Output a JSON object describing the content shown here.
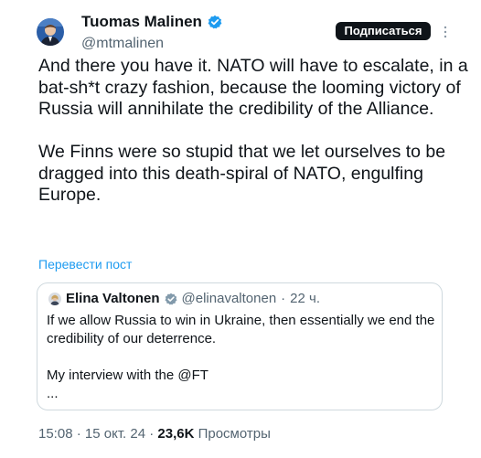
{
  "author": {
    "display_name": "Tuomas Malinen",
    "handle": "@mtmalinen",
    "verified_badge_icon": "verified-check-icon"
  },
  "follow_button_label": "Подписаться",
  "more_icon": "more-vertical-icon",
  "tweet": {
    "paragraph_1": "And there you have it. NATO will have to escalate, in a bat-sh*t crazy fashion, because the looming victory of Russia will annihilate the credibility of the Alliance.",
    "paragraph_2": "We Finns were so stupid that we let ourselves to be dragged into this death-spiral of NATO, engulfing Europe.",
    "translate_link": "Перевести пост"
  },
  "quoted_tweet": {
    "display_name": "Elina Valtonen",
    "handle": "@elinavaltonen",
    "separator": "·",
    "time_ago": "22 ч.",
    "line_1": "If we allow Russia to win in Ukraine, then essentially we end the credibility of our deterrence.",
    "line_2": "My interview with the @FT",
    "ellipsis": "..."
  },
  "meta": {
    "time": "15:08",
    "date": "15 окт. 24",
    "sep": "·",
    "views_count": "23,6K",
    "views_label": "Просмотры"
  },
  "colors": {
    "text": "#0f1419",
    "secondary": "#536471",
    "link": "#1d9bf0",
    "border": "#cfd9de"
  }
}
